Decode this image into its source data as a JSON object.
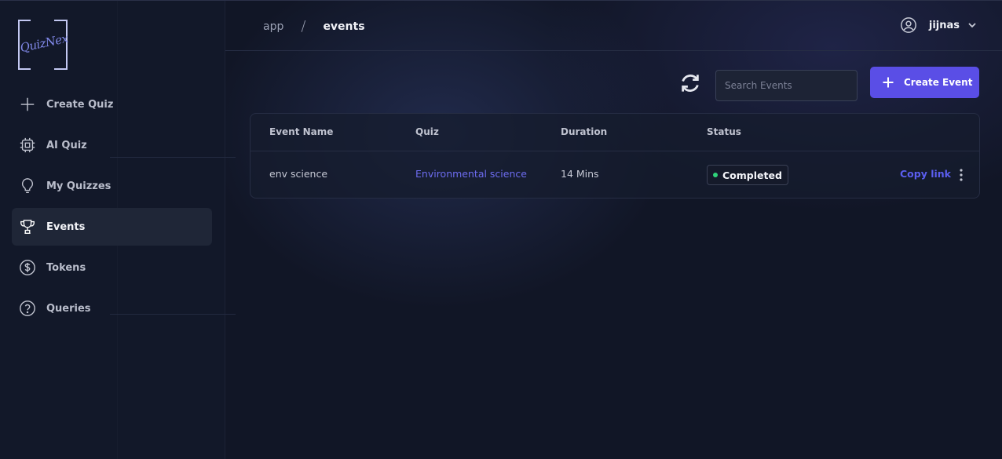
{
  "app": {
    "logo_text": "QuizNex"
  },
  "sidebar": {
    "items": [
      {
        "label": "Create Quiz",
        "icon": "plus-icon",
        "active": false
      },
      {
        "label": "AI Quiz",
        "icon": "cpu-chip-icon",
        "active": false
      },
      {
        "label": "My Quizzes",
        "icon": "lightbulb-icon",
        "active": false
      },
      {
        "label": "Events",
        "icon": "trophy-icon",
        "active": true
      },
      {
        "label": "Tokens",
        "icon": "dollar-coin-icon",
        "active": false
      },
      {
        "label": "Queries",
        "icon": "question-circle-icon",
        "active": false
      }
    ]
  },
  "header": {
    "breadcrumb": {
      "root": "app",
      "separator": "/",
      "current": "events"
    },
    "user": {
      "name": "jijnas"
    }
  },
  "toolbar": {
    "search_placeholder": "Search Events",
    "search_value": "",
    "create_label": "Create Event"
  },
  "table": {
    "columns": [
      "Event Name",
      "Quiz",
      "Duration",
      "Status"
    ],
    "rows": [
      {
        "event_name": "env science",
        "quiz": "Environmental science",
        "duration": "14 Mins",
        "status": "Completed",
        "action": "Copy link"
      }
    ]
  },
  "colors": {
    "accent": "#5a4ee6",
    "link": "#6d6cf0",
    "status_completed": "#2fd37a",
    "background": "#111626"
  }
}
